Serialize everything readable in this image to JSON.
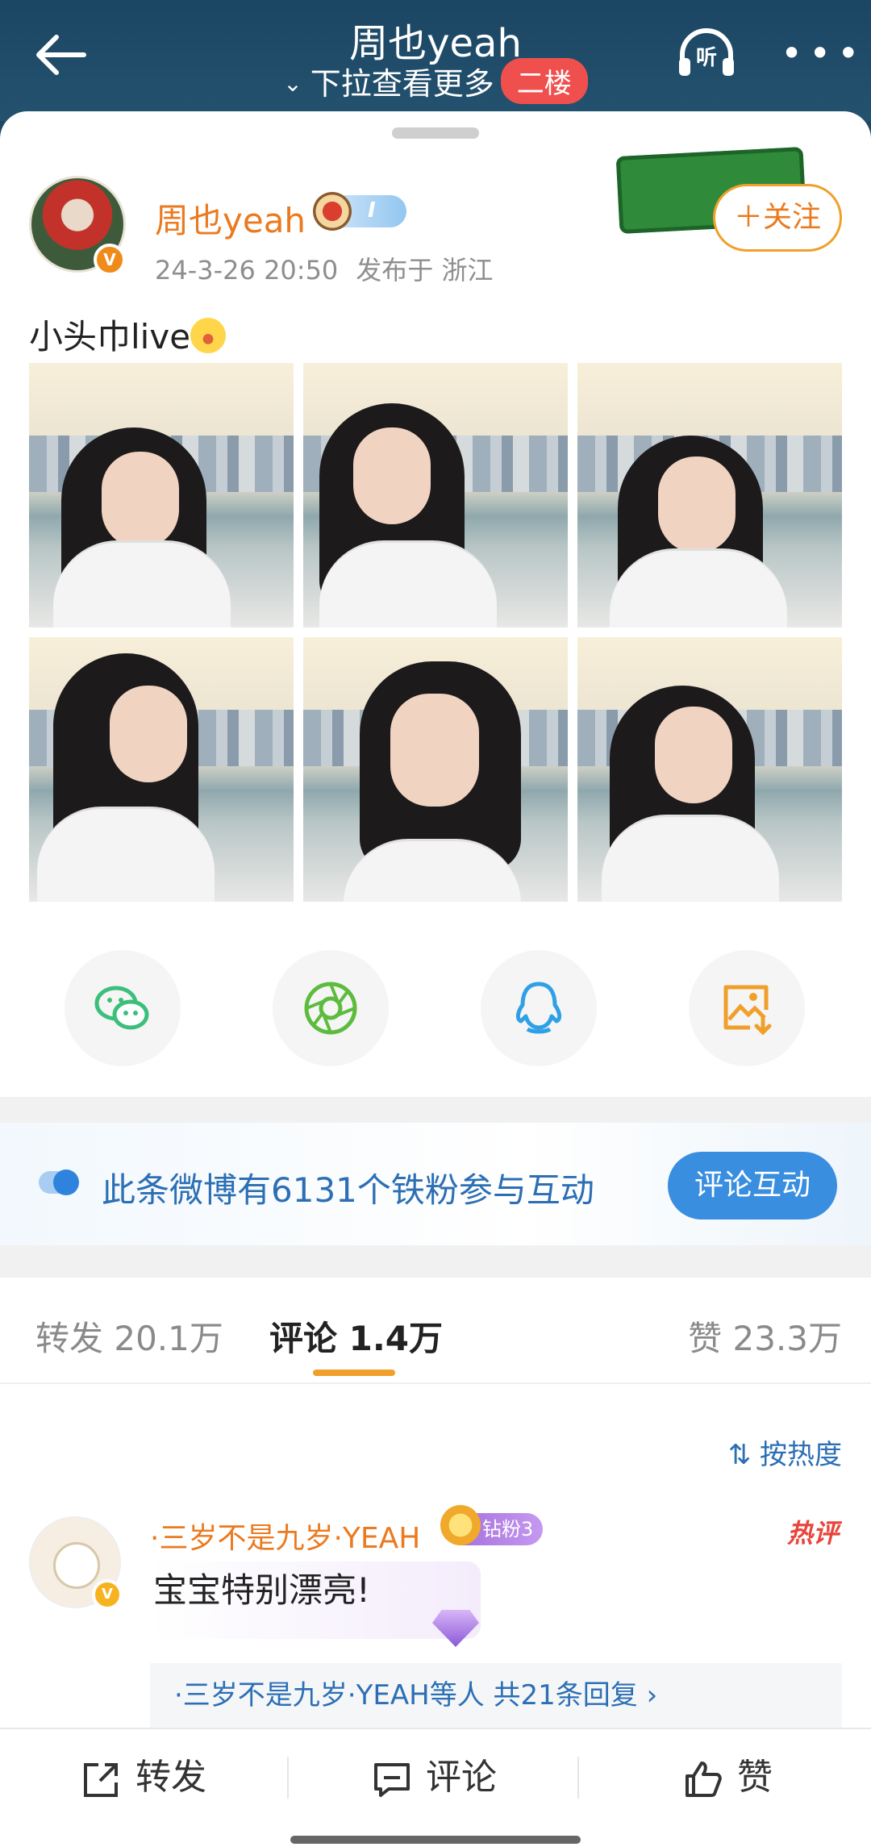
{
  "header": {
    "title": "周也yeah",
    "subtitle": "下拉查看更多",
    "floor_tag": "二楼",
    "listen_label": "听"
  },
  "post": {
    "author": "周也yeah",
    "time": "24-3-26 20:50",
    "location": "发布于 浙江",
    "follow_label": "＋关注",
    "text": "小头巾live",
    "badge_level": "I",
    "photo_count": 6
  },
  "share_icons": [
    "wechat-icon",
    "moments-icon",
    "qq-icon",
    "save-image-icon"
  ],
  "banner": {
    "text": "此条微博有6131个铁粉参与互动",
    "button": "评论互动"
  },
  "tabs": [
    {
      "label": "转发 20.1万"
    },
    {
      "label": "评论 1.4万"
    },
    {
      "label": "赞 23.3万"
    }
  ],
  "sort_label": "按热度",
  "comment": {
    "user": "·三岁不是九岁·YEAH",
    "fan_badge": "钻粉3",
    "hot_tag": "热评",
    "text": "宝宝特别漂亮!",
    "replies": "·三岁不是九岁·YEAH等人  共21条回复 ›"
  },
  "bottom_bar": {
    "repost": "转发",
    "comment": "评论",
    "like": "赞"
  },
  "colors": {
    "header_bg": "#1e4866",
    "accent_orange": "#eb7a1f",
    "link_blue": "#2c6fb4",
    "button_blue": "#3a8ee0"
  }
}
